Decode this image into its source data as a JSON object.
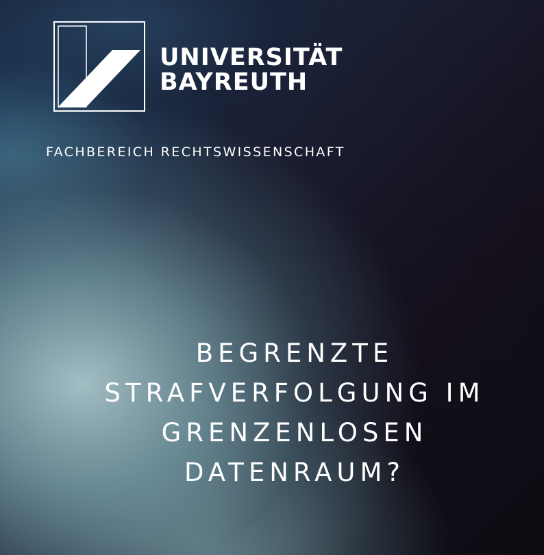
{
  "logo": {
    "icon": "university-bayreuth-logo-icon",
    "line1": "UNIVERSITÄT",
    "line2": "BAYREUTH"
  },
  "department": "FACHBEREICH RECHTSWISSENSCHAFT",
  "title_lines": [
    "BEGRENZTE",
    "STRAFVERFOLGUNG IM",
    "GRENZENLOSEN",
    "DATENRAUM?"
  ],
  "colors": {
    "text": "#ffffff",
    "background_dark": "#0c0b11",
    "background_teal": "#aac8cd"
  }
}
